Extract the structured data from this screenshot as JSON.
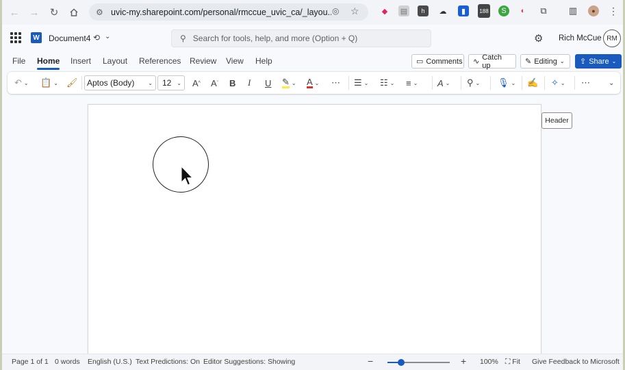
{
  "browser": {
    "url": "uvic-my.sharepoint.com/personal/rmccue_uvic_ca/_layou...",
    "ext_badge": "188"
  },
  "office": {
    "doc_name": "Document4",
    "search_placeholder": "Search for tools, help, and more (Option + Q)",
    "user_name": "Rich McCue",
    "user_initials": "RM"
  },
  "tabs": [
    "File",
    "Home",
    "Insert",
    "Layout",
    "References",
    "Review",
    "View",
    "Help"
  ],
  "active_tab": "Home",
  "ribbon_right": {
    "comments": "Comments",
    "catchup": "Catch up",
    "editing": "Editing",
    "share": "Share"
  },
  "toolbar": {
    "font": "Aptos (Body)",
    "size": "12",
    "bold": "B",
    "italic": "I",
    "underline": "U"
  },
  "canvas": {
    "tooltip": "Header"
  },
  "status": {
    "page": "Page 1 of 1",
    "words": "0 words",
    "language": "English (U.S.)",
    "predictions": "Text Predictions: On",
    "editor": "Editor Suggestions: Showing",
    "zoom": "100%",
    "fit": "Fit",
    "feedback": "Give Feedback to Microsoft",
    "zoom_level": 0.22
  },
  "colors": {
    "accent": "#185abd",
    "highlight": "#ffeb3b",
    "font_color": "#e0302e"
  }
}
